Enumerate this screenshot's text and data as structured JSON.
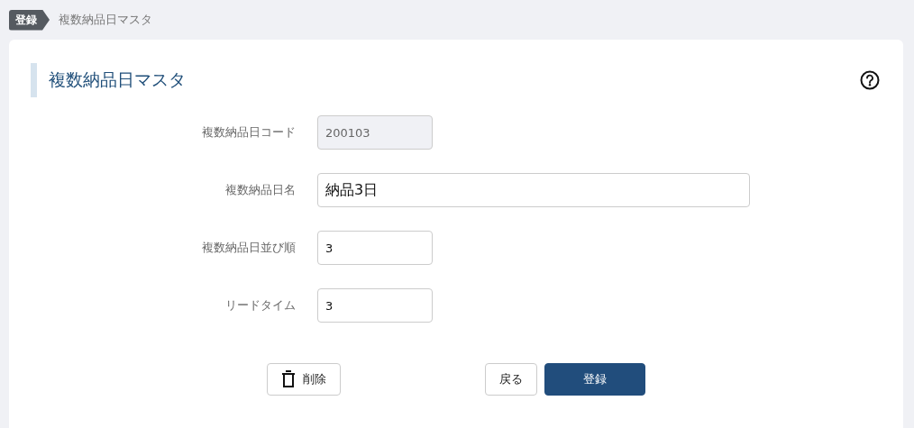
{
  "breadcrumb": {
    "badge": "登録",
    "current": "複数納品日マスタ"
  },
  "card": {
    "title": "複数納品日マスタ"
  },
  "fields": [
    {
      "label": "複数納品日コード",
      "value": "200103",
      "kind": "short",
      "disabled": true
    },
    {
      "label": "複数納品日名",
      "value": "納品3日",
      "kind": "wide",
      "disabled": false
    },
    {
      "label": "複数納品日並び順",
      "value": "3",
      "kind": "short",
      "disabled": false
    },
    {
      "label": "リードタイム",
      "value": "3",
      "kind": "short",
      "disabled": false
    }
  ],
  "buttons": [
    {
      "label": "削除",
      "kind": "delete"
    },
    {
      "label": "戻る",
      "kind": "back"
    },
    {
      "label": "登録",
      "kind": "primary"
    }
  ]
}
